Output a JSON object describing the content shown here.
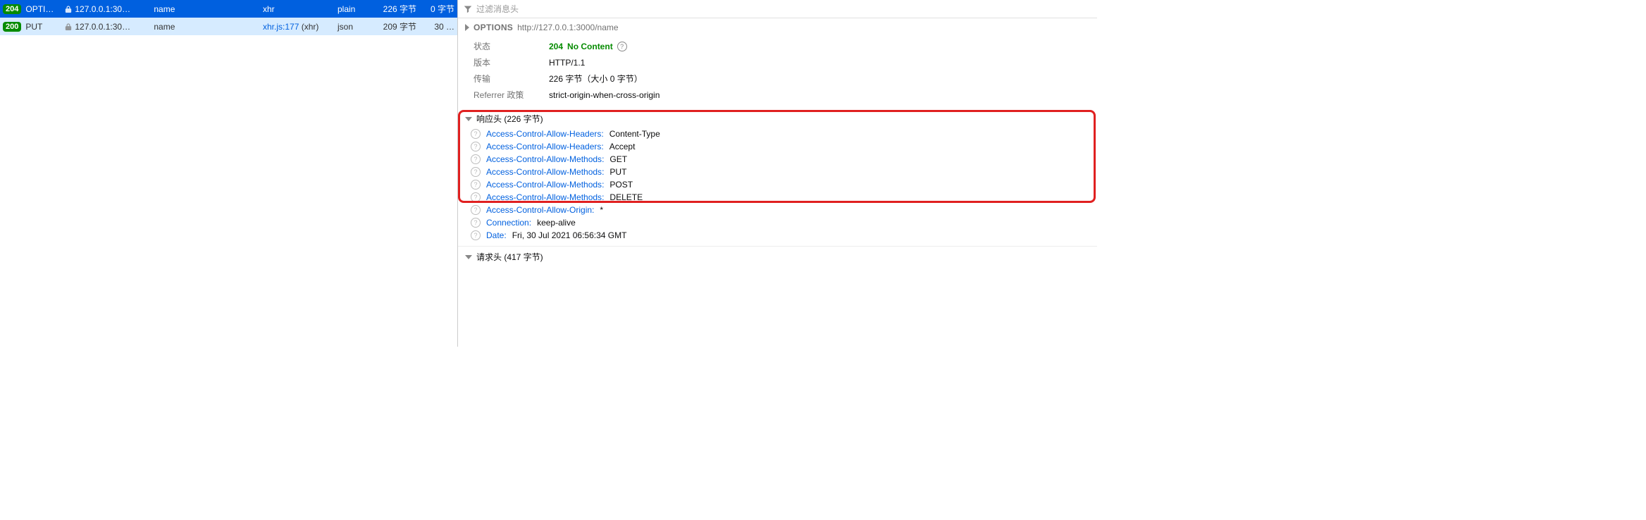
{
  "filter": {
    "placeholder": "过滤消息头"
  },
  "requests": [
    {
      "status": "204",
      "method": "OPTI…",
      "domain": "127.0.0.1:30…",
      "file": "name",
      "initiator": "xhr",
      "type": "plain",
      "transferred": "226 字节",
      "size": "0 字节"
    },
    {
      "status": "200",
      "method": "PUT",
      "domain": "127.0.0.1:30…",
      "file": "name",
      "initiator_link": "xhr.js:177",
      "initiator_suffix": " (xhr)",
      "type": "json",
      "transferred": "209 字节",
      "size": "30 …"
    }
  ],
  "detail": {
    "method": "OPTIONS",
    "url": "http://127.0.0.1:3000/name",
    "summary": {
      "status_label": "状态",
      "status_code": "204",
      "status_text": "No Content",
      "version_label": "版本",
      "version_value": "HTTP/1.1",
      "transferred_label": "传输",
      "transferred_value": "226 字节（大小 0 字节）",
      "referrer_label": "Referrer 政策",
      "referrer_value": "strict-origin-when-cross-origin"
    },
    "response_title": "响应头 (226 字节)",
    "response_headers": [
      {
        "name": "Access-Control-Allow-Headers",
        "value": "Content-Type"
      },
      {
        "name": "Access-Control-Allow-Headers",
        "value": "Accept"
      },
      {
        "name": "Access-Control-Allow-Methods",
        "value": "GET"
      },
      {
        "name": "Access-Control-Allow-Methods",
        "value": "PUT"
      },
      {
        "name": "Access-Control-Allow-Methods",
        "value": "POST"
      },
      {
        "name": "Access-Control-Allow-Methods",
        "value": "DELETE"
      },
      {
        "name": "Access-Control-Allow-Origin",
        "value": "*"
      },
      {
        "name": "Connection",
        "value": "keep-alive"
      },
      {
        "name": "Date",
        "value": "Fri, 30 Jul 2021 06:56:34 GMT"
      }
    ],
    "request_title": "请求头 (417 字节)"
  }
}
